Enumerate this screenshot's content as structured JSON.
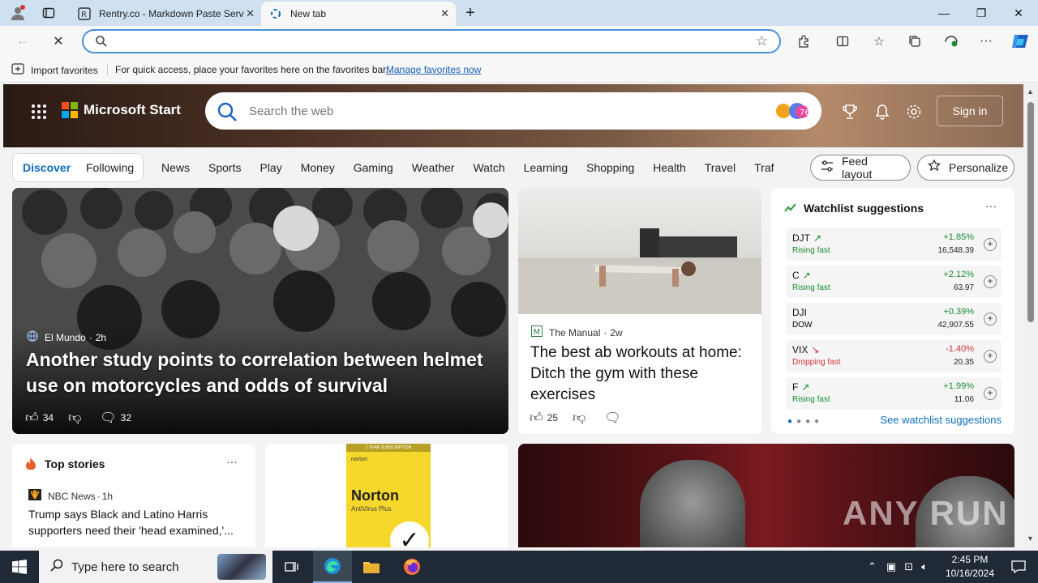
{
  "browser": {
    "tabs": [
      {
        "label": "Rentry.co - Markdown Paste Serv",
        "favicon": "rentry-icon",
        "active": false
      },
      {
        "label": "New tab",
        "favicon": "loading-icon",
        "active": true
      }
    ],
    "new_tab_symbol": "+",
    "window_controls": {
      "minimize": "—",
      "maximize": "❐",
      "close": "✕"
    },
    "address": {
      "value": "",
      "placeholder": ""
    },
    "toolbar_icons": [
      "extensions-icon",
      "split-screen-icon",
      "favorites-icon",
      "collections-icon",
      "performance-icon",
      "more-icon",
      "copilot-icon"
    ]
  },
  "favorites_bar": {
    "import_label": "Import favorites",
    "message": "For quick access, place your favorites here on the favorites bar.",
    "link": "Manage favorites now"
  },
  "header": {
    "brand": "Microsoft Start",
    "search_placeholder": "Search the web",
    "copilot_badge": "76",
    "signin": "Sign in"
  },
  "nav": {
    "discover": "Discover",
    "following": "Following",
    "links": [
      "News",
      "Sports",
      "Play",
      "Money",
      "Gaming",
      "Weather",
      "Watch",
      "Learning",
      "Shopping",
      "Health",
      "Travel",
      "Traf"
    ],
    "feed_layout": "Feed layout",
    "personalize": "Personalize"
  },
  "hero": {
    "source": "El Mundo",
    "age": "2h",
    "headline": "Another study points to correlation between helmet use on motorcycles and odds of survival",
    "likes": "34",
    "comments": "32"
  },
  "ab_article": {
    "source": "The Manual",
    "age": "2w",
    "headline": "The best ab workouts at home: Ditch the gym with these exercises",
    "likes": "25"
  },
  "watchlist": {
    "title": "Watchlist suggestions",
    "more": "···",
    "stocks": [
      {
        "symbol": "DJT",
        "status": "Rising fast",
        "change": "+1.85%",
        "value": "16,548.39",
        "trend": "up"
      },
      {
        "symbol": "C",
        "status": "Rising fast",
        "change": "+2.12%",
        "value": "63.97",
        "trend": "up"
      },
      {
        "symbol": "DJI",
        "status": "DOW",
        "change": "+0.39%",
        "value": "42,907.55",
        "trend": "up"
      },
      {
        "symbol": "VIX",
        "status": "Dropping fast",
        "change": "-1.40%",
        "value": "20.35",
        "trend": "down"
      },
      {
        "symbol": "F",
        "status": "Rising fast",
        "change": "+1.99%",
        "value": "11.06",
        "trend": "up"
      }
    ],
    "see_more": "See watchlist suggestions"
  },
  "top_stories": {
    "title": "Top stories",
    "more": "···",
    "source": "NBC News",
    "age": "1h",
    "headline": "Trump says Black and Latino Harris supporters need their 'head examined,'..."
  },
  "ad": {
    "band": "1 YEAR SUBSCRIPTION",
    "small": "norton",
    "brand": "Norton",
    "product": "AntiVirus Plus"
  },
  "watermark": "ANY RUN",
  "taskbar": {
    "search_placeholder": "Type here to search",
    "time": "2:45 PM",
    "date": "10/16/2024"
  },
  "colors": {
    "accent": "#0f6cbd",
    "up": "#1a8a2e",
    "down": "#d13438",
    "taskbar": "#1f2a36"
  }
}
